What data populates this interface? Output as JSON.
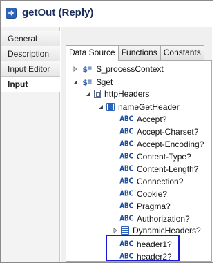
{
  "window": {
    "title": "getOut (Reply)"
  },
  "left_nav": {
    "items": [
      {
        "label": "General",
        "selected": false
      },
      {
        "label": "Description",
        "selected": false
      },
      {
        "label": "Input Editor",
        "selected": false
      },
      {
        "label": "Input",
        "selected": true
      }
    ]
  },
  "tabs": [
    {
      "label": "Data Source",
      "active": true
    },
    {
      "label": "Functions",
      "active": false
    },
    {
      "label": "Constants",
      "active": false
    }
  ],
  "tree": {
    "process_context": {
      "label": "$_processContext",
      "expanded": false
    },
    "get": {
      "label": "$get",
      "expanded": true
    },
    "http_headers": {
      "label": "httpHeaders",
      "expanded": true
    },
    "name_get_header": {
      "label": "nameGetHeader",
      "expanded": true
    },
    "fields": [
      "Accept?",
      "Accept-Charset?",
      "Accept-Encoding?",
      "Content-Type?",
      "Content-Length?",
      "Connection?",
      "Cookie?",
      "Pragma?",
      "Authorization?"
    ],
    "dynamic_headers": {
      "label": "DynamicHeaders?",
      "expanded": false
    },
    "custom_headers": [
      "header1?",
      "header2?"
    ]
  },
  "icons": {
    "string_field": "abc-icon",
    "variable": "dollar-variable-icon",
    "node": "complex-node-icon"
  },
  "colors": {
    "highlight_border": "#1a1ad6",
    "icon_blue": "#2d63b8",
    "title_text": "#1b2e5c"
  }
}
